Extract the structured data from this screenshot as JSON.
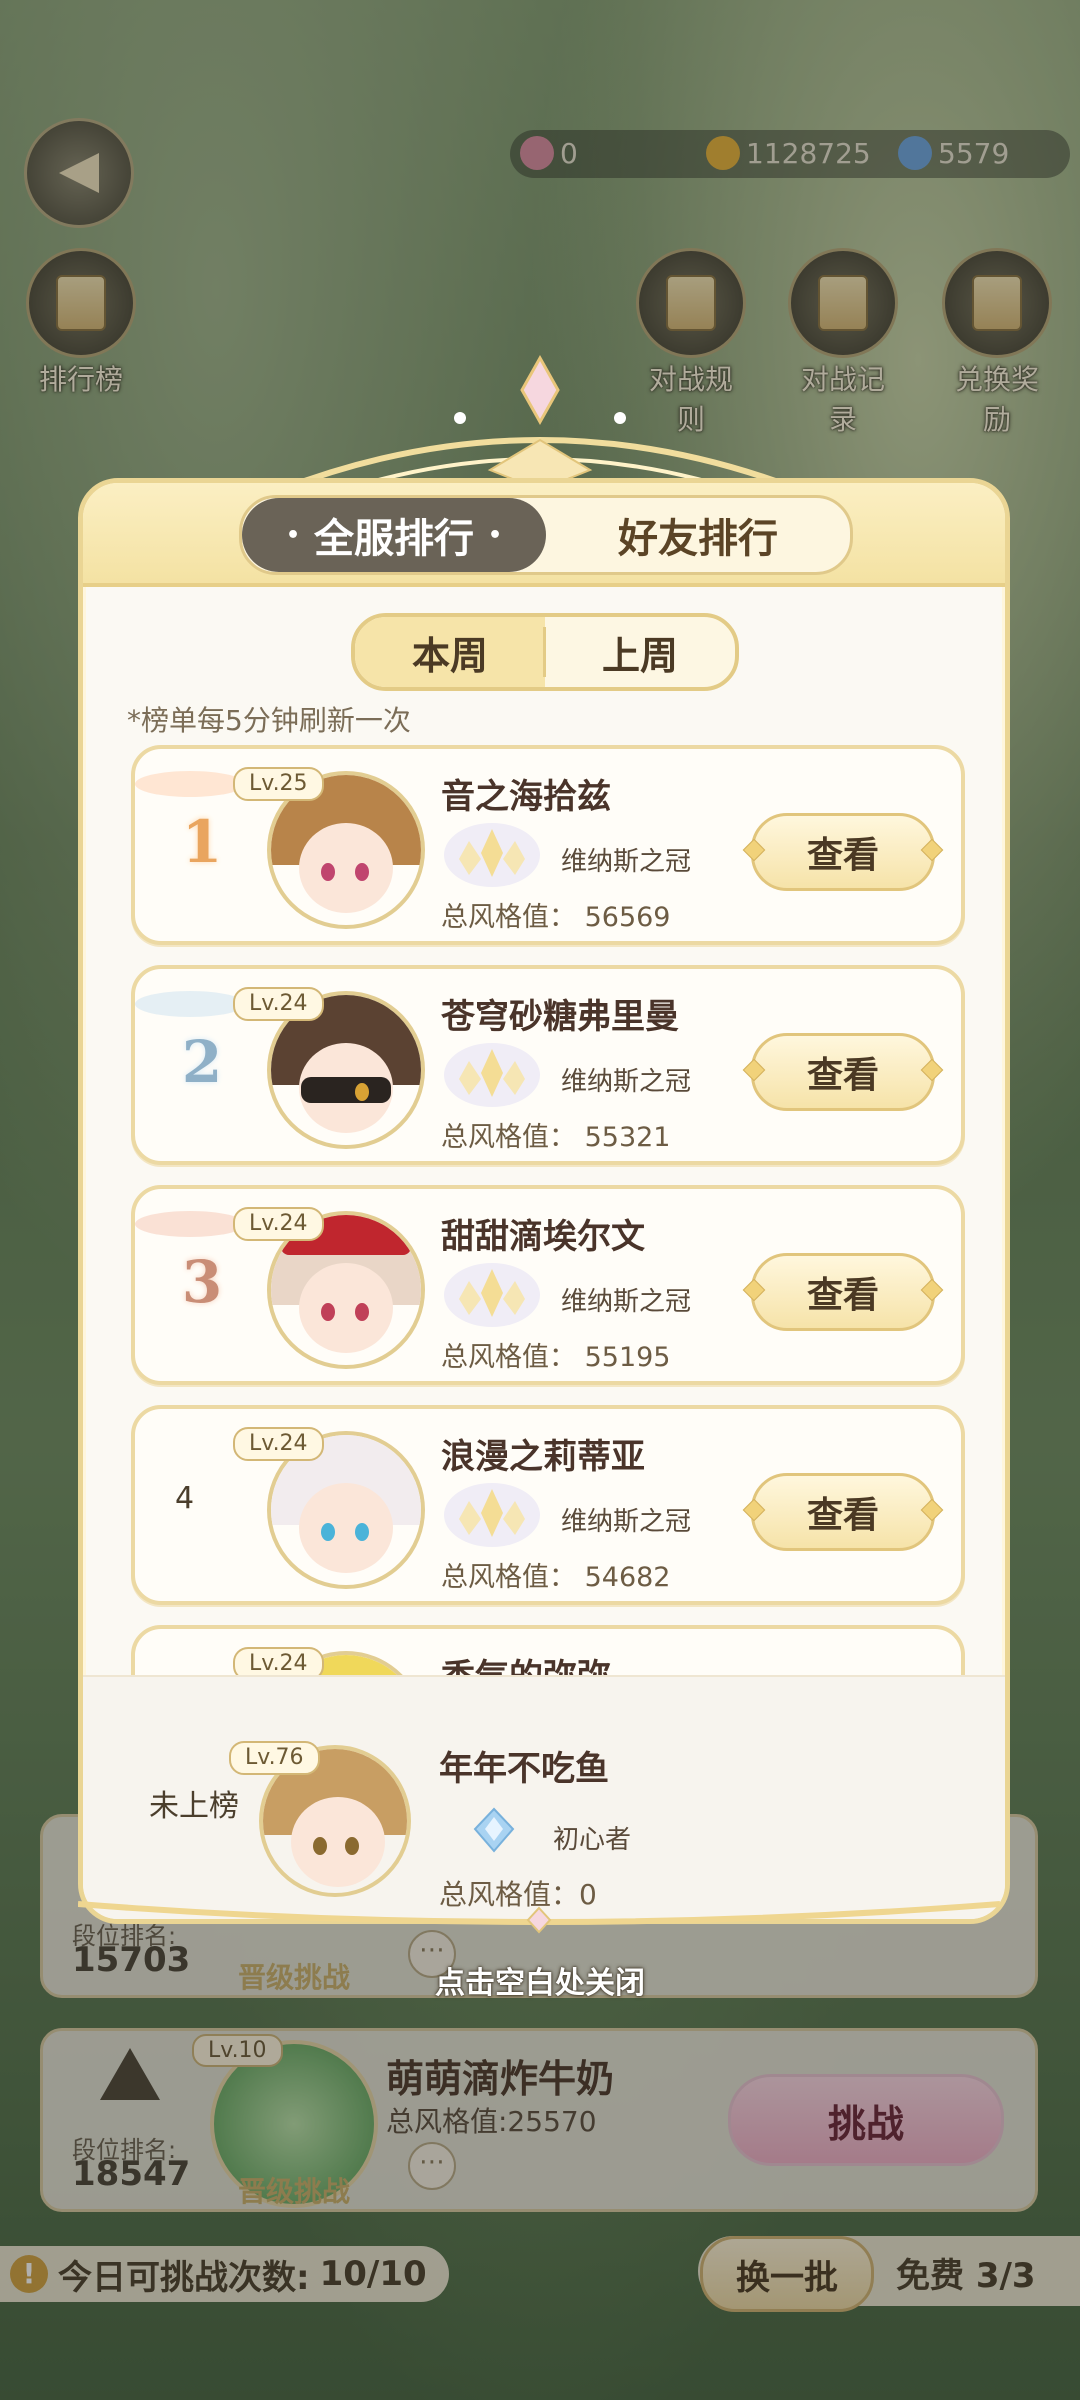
{
  "currencies": [
    {
      "icon": "pink-gem-icon",
      "value": "0",
      "color": "#d98ca0"
    },
    {
      "icon": "gold-coin-icon",
      "value": "1128725",
      "color": "#e6b23a"
    },
    {
      "icon": "blue-crystal-icon",
      "value": "5579",
      "color": "#6ea6e0"
    }
  ],
  "top_icons": {
    "leaderboard": "排行榜",
    "rules": "对战规则",
    "records": "对战记录",
    "rewards": "兑换奖励"
  },
  "modal": {
    "tabs": {
      "all_server": "全服排行",
      "friends": "好友排行"
    },
    "week_tabs": {
      "this_week": "本周",
      "last_week": "上周"
    },
    "refresh_note": "*榜单每5分钟刷新一次",
    "view_label": "查看",
    "score_label": "总风格值：",
    "ranking": [
      {
        "rank": "1",
        "level": "Lv.25",
        "name": "音之海拾兹",
        "title": "维纳斯之冠",
        "score": "56569",
        "hair": "#b8844a",
        "eye": "#c0456e"
      },
      {
        "rank": "2",
        "level": "Lv.24",
        "name": "苍穹砂糖弗里曼",
        "title": "维纳斯之冠",
        "score": "55321",
        "hair": "#5b4232",
        "eye": "#d8a234"
      },
      {
        "rank": "3",
        "level": "Lv.24",
        "name": "甜甜滴埃尔文",
        "title": "维纳斯之冠",
        "score": "55195",
        "hair": "#e9d6c7",
        "eye": "#c04058"
      },
      {
        "rank": "4",
        "level": "Lv.24",
        "name": "浪漫之莉蒂亚",
        "title": "维纳斯之冠",
        "score": "54682",
        "hair": "#f2ecee",
        "eye": "#4ab3d9"
      },
      {
        "rank": "",
        "level": "Lv.24",
        "name": "香气的弥弥",
        "title": "",
        "score": "",
        "hair": "#f0d85a",
        "eye": "#8a6a30"
      }
    ],
    "me": {
      "rank_text": "未上榜",
      "level": "Lv.76",
      "name": "年年不吃鱼",
      "title": "初心者",
      "score_label": "总风格值：",
      "score": "0"
    }
  },
  "close_hint": "点击空白处关闭",
  "background_cards": [
    {
      "rank_label": "段位排名:",
      "rank": "15703",
      "promo": "晋级挑战"
    },
    {
      "rank_label": "段位排名:",
      "rank": "18547",
      "promo": "晋级挑战",
      "level": "Lv.10",
      "name": "萌萌滴炸牛奶",
      "score": "总风格值:25570",
      "button": "挑战"
    }
  ],
  "bottom": {
    "attempts_label": "今日可挑战次数:",
    "attempts_value": "10/10",
    "refresh_button": "换一批",
    "free_text": "免费 3/3"
  }
}
